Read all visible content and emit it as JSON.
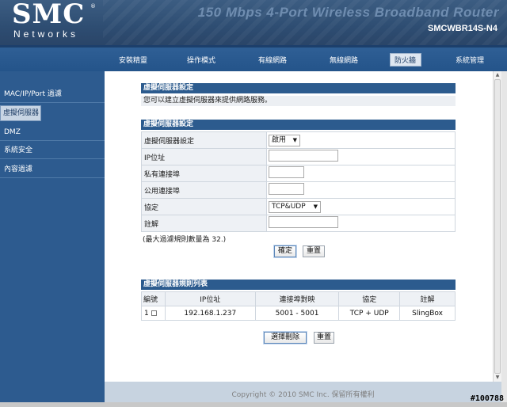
{
  "header": {
    "logo": "SMC",
    "logo_sub": "Networks",
    "logo_reg": "®",
    "banner_title": "150 Mbps 4-Port Wireless Broadband Router",
    "model": "SMCWBR14S-N4"
  },
  "nav": {
    "items": [
      {
        "label": "安裝精靈"
      },
      {
        "label": "操作模式"
      },
      {
        "label": "有線網路"
      },
      {
        "label": "無線網路"
      },
      {
        "label": "防火牆"
      },
      {
        "label": "系統管理"
      }
    ],
    "active_index": 4
  },
  "sidebar": {
    "items": [
      {
        "label": "MAC/IP/Port 過濾"
      },
      {
        "label": "虛擬伺服器"
      },
      {
        "label": "DMZ"
      },
      {
        "label": "系統安全"
      },
      {
        "label": "內容過濾"
      }
    ],
    "active_index": 1
  },
  "section1": {
    "title": "虛擬伺服器設定",
    "description": "您可以建立虛擬伺服器來提供網路服務。"
  },
  "form": {
    "title": "虛擬伺服器設定",
    "rows": {
      "enable_label": "虛擬伺服器設定",
      "enable_value": "啟用",
      "ip_label": "IP位址",
      "ip_value": "",
      "private_port_label": "私有連接埠",
      "private_port_value": "",
      "public_port_label": "公用連接埠",
      "public_port_value": "",
      "protocol_label": "協定",
      "protocol_value": "TCP&UDP",
      "comment_label": "註解",
      "comment_value": ""
    },
    "max_note": "(最大過濾規則數量為 32.)",
    "apply_label": "確定",
    "reset_label": "重置"
  },
  "rules_table": {
    "title": "虛擬伺服器規則列表",
    "columns": [
      "編號",
      "IP位址",
      "連接埠對映",
      "協定",
      "註解"
    ],
    "rows": [
      {
        "no": "1",
        "ip": "192.168.1.237",
        "port_map": "5001 - 5001",
        "protocol": "TCP + UDP",
        "comment": "SlingBox"
      }
    ],
    "delete_label": "選擇刪除",
    "reset_label": "重置"
  },
  "footer": {
    "copyright": "Copyright © 2010 SMC Inc. 保留所有權利"
  },
  "watermark": "#100788",
  "colors": {
    "header_bg": "#2e4d72",
    "nav_bg": "#2f5f95",
    "sidebar_bg": "#2d5b8f",
    "section_header_bg": "#2c5b8e",
    "banner_text": "#6f8db0"
  }
}
